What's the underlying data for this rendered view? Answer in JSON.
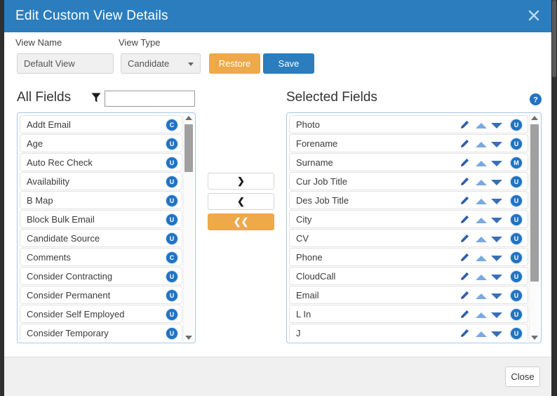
{
  "window": {
    "title": "Edit Custom View Details",
    "close_icon": "close-x-icon"
  },
  "form": {
    "view_name_label": "View Name",
    "view_name_value": "Default View",
    "view_type_label": "View Type",
    "view_type_value": "Candidate",
    "view_type_options": [
      "Candidate"
    ],
    "restore_label": "Restore",
    "save_label": "Save",
    "restore_color": "#eda94a",
    "save_color": "#2b7dbd"
  },
  "all_fields": {
    "heading": "All Fields",
    "filter_icon": "filter-funnel-icon",
    "filter_value": "",
    "filter_placeholder": "",
    "items": [
      {
        "label": "Addt Email",
        "badge": "C"
      },
      {
        "label": "Age",
        "badge": "U"
      },
      {
        "label": "Auto Rec Check",
        "badge": "U"
      },
      {
        "label": "Availability",
        "badge": "U"
      },
      {
        "label": "B Map",
        "badge": "U"
      },
      {
        "label": "Block Bulk Email",
        "badge": "U"
      },
      {
        "label": "Candidate Source",
        "badge": "U"
      },
      {
        "label": "Comments",
        "badge": "C"
      },
      {
        "label": "Consider Contracting",
        "badge": "U"
      },
      {
        "label": "Consider Permanent",
        "badge": "U"
      },
      {
        "label": "Consider Self Employed",
        "badge": "U"
      },
      {
        "label": "Consider Temporary",
        "badge": "U"
      }
    ]
  },
  "selected_fields": {
    "heading": "Selected Fields",
    "help_icon": "help-question-icon",
    "items": [
      {
        "label": "Photo",
        "badge": "U"
      },
      {
        "label": "Forename",
        "badge": "U"
      },
      {
        "label": "Surname",
        "badge": "M"
      },
      {
        "label": "Cur Job Title",
        "badge": "U"
      },
      {
        "label": "Des Job Title",
        "badge": "U"
      },
      {
        "label": "City",
        "badge": "U"
      },
      {
        "label": "CV",
        "badge": "U"
      },
      {
        "label": "Phone",
        "badge": "U"
      },
      {
        "label": "CloudCall",
        "badge": "U"
      },
      {
        "label": "Email",
        "badge": "U"
      },
      {
        "label": "L In",
        "badge": "U"
      },
      {
        "label": "J",
        "badge": "U"
      }
    ],
    "row_icons": {
      "edit": "pencil-icon",
      "move_up": "triangle-up-icon",
      "move_down": "triangle-down-icon"
    }
  },
  "transfer": {
    "add_label": "❯",
    "remove_label": "❮",
    "remove_all_label": "❮❮",
    "add_icon": "chevron-right-icon",
    "remove_icon": "chevron-left-icon",
    "remove_all_icon": "double-chevron-left-icon",
    "remove_all_color": "#eda94a"
  },
  "footer": {
    "close_label": "Close"
  },
  "colors": {
    "title_bar": "#2b7dbd",
    "badge": "#2173c4",
    "panel_border": "#a8c8e8",
    "footer_bg": "#f0f0f0"
  }
}
